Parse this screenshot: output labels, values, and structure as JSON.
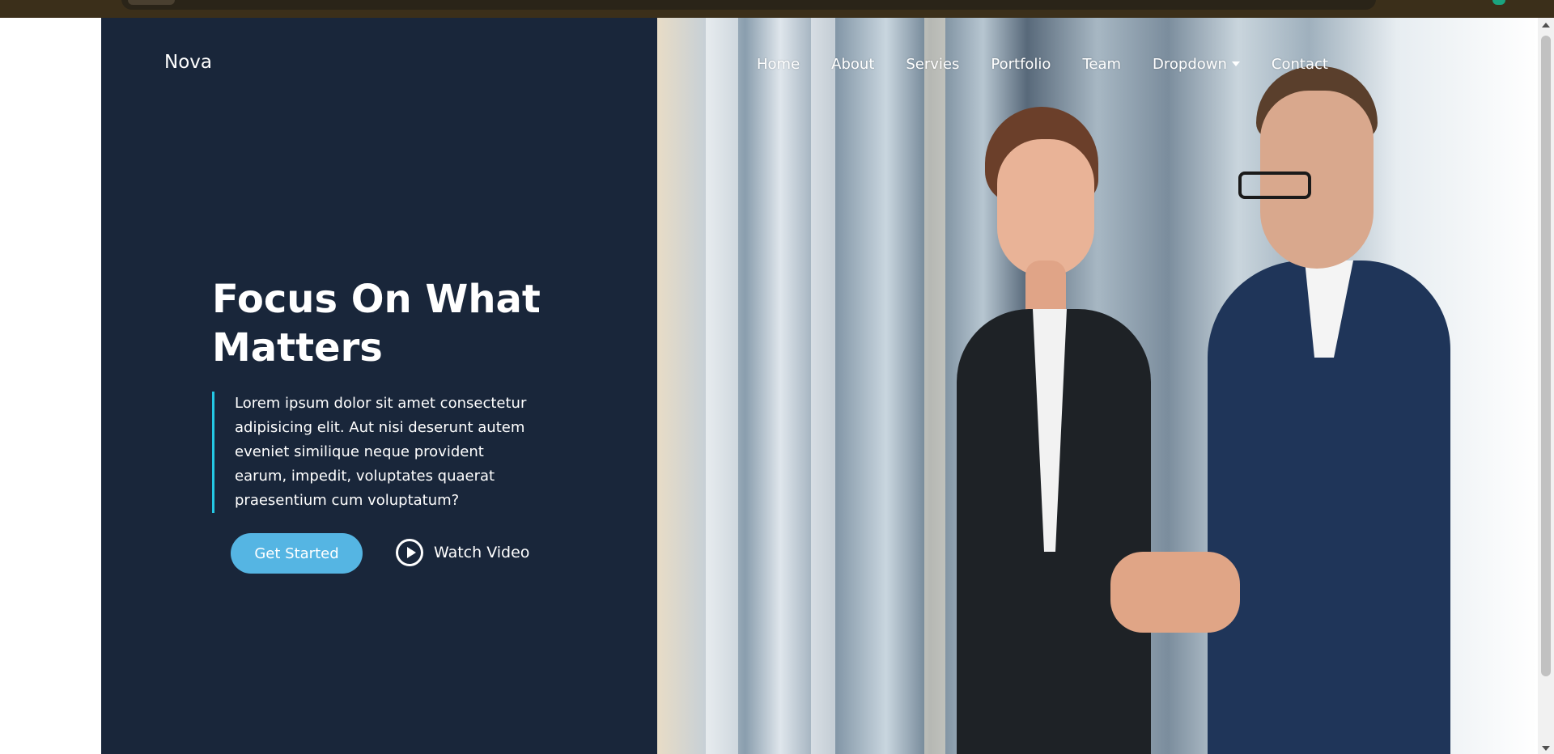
{
  "navbar": {
    "brand": "Nova",
    "items": [
      {
        "label": "Home"
      },
      {
        "label": "About"
      },
      {
        "label": "Servies"
      },
      {
        "label": "Portfolio"
      },
      {
        "label": "Team"
      },
      {
        "label": "Dropdown",
        "icon": "caret-down-icon"
      },
      {
        "label": "Contact"
      }
    ]
  },
  "hero": {
    "title": "Focus On What Matters",
    "description": "Lorem ipsum dolor sit amet consectetur adipisicing elit. Aut nisi deserunt autem eveniet similique neque provident earum, impedit, voluptates quaerat praesentium cum voluptatum?",
    "get_started_label": "Get Started",
    "watch_video_label": "Watch Video",
    "watch_video_icon": "play-circle-icon"
  },
  "colors": {
    "panel": "#19263a",
    "accent_button": "#55b5e3",
    "accent_border": "#24c8e4"
  }
}
